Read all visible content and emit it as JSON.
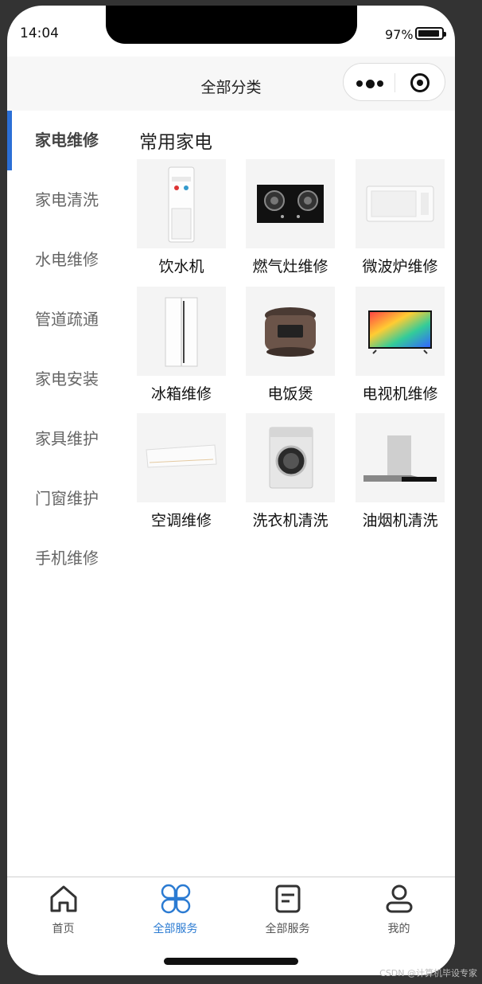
{
  "status": {
    "time": "14:04",
    "battery": "97%"
  },
  "navbar": {
    "title": "全部分类"
  },
  "sidebar": {
    "items": [
      {
        "label": "家电维修",
        "active": true
      },
      {
        "label": "家电清洗"
      },
      {
        "label": "水电维修"
      },
      {
        "label": "管道疏通"
      },
      {
        "label": "家电安装"
      },
      {
        "label": "家具维护"
      },
      {
        "label": "门窗维护"
      },
      {
        "label": "手机维修"
      }
    ]
  },
  "section": {
    "title": "常用家电",
    "items": [
      {
        "label": "饮水机",
        "icon": "water-dispenser-image"
      },
      {
        "label": "燃气灶维修",
        "icon": "gas-stove-image"
      },
      {
        "label": "微波炉维修",
        "icon": "microwave-image"
      },
      {
        "label": "冰箱维修",
        "icon": "refrigerator-image"
      },
      {
        "label": "电饭煲",
        "icon": "rice-cooker-image"
      },
      {
        "label": "电视机维修",
        "icon": "television-image"
      },
      {
        "label": "空调维修",
        "icon": "air-conditioner-image"
      },
      {
        "label": "洗衣机清洗",
        "icon": "washing-machine-image"
      },
      {
        "label": "油烟机清洗",
        "icon": "range-hood-image"
      }
    ]
  },
  "tabbar": {
    "items": [
      {
        "label": "首页",
        "icon": "home-icon"
      },
      {
        "label": "全部服务",
        "icon": "grid-clover-icon",
        "active": true
      },
      {
        "label": "全部服务",
        "icon": "document-icon"
      },
      {
        "label": "我的",
        "icon": "user-icon"
      }
    ],
    "accent": "#2b7bd2"
  },
  "watermark": "CSDN @计算机毕设专家"
}
